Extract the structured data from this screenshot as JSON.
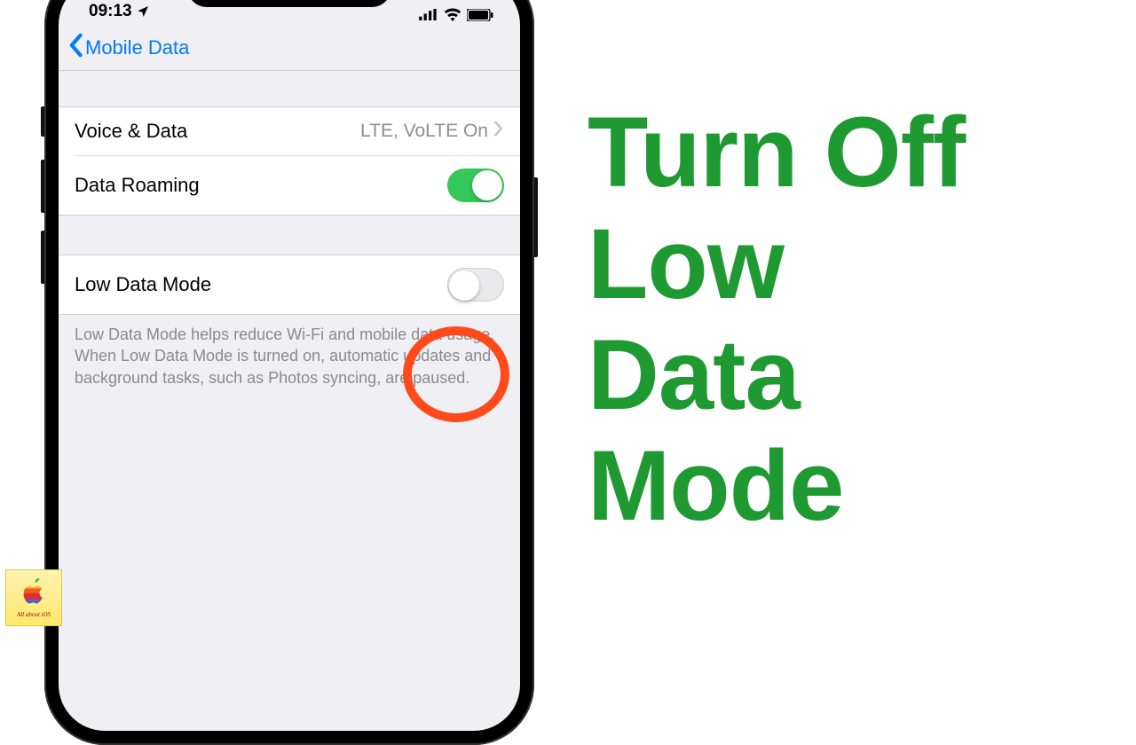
{
  "statusbar": {
    "time": "09:13"
  },
  "nav": {
    "back_label": "Mobile Data"
  },
  "rows": {
    "voice_data": {
      "label": "Voice & Data",
      "value": "LTE, VoLTE On"
    },
    "data_roaming": {
      "label": "Data Roaming",
      "on": true
    },
    "low_data_mode": {
      "label": "Low Data Mode",
      "on": false
    }
  },
  "footer": "Low Data Mode helps reduce Wi-Fi and mobile data usage. When Low Data Mode is turned on, automatic updates and background tasks, such as Photos syncing, are paused.",
  "headline": {
    "l1": "Turn Off",
    "l2": "Low",
    "l3": "Data",
    "l4": "Mode"
  },
  "badge": {
    "caption": "All about iOS"
  },
  "colors": {
    "accent_green": "#1f9a32",
    "ios_blue": "#007aff",
    "toggle_green": "#34c759",
    "annotation": "#ff4a1c"
  }
}
